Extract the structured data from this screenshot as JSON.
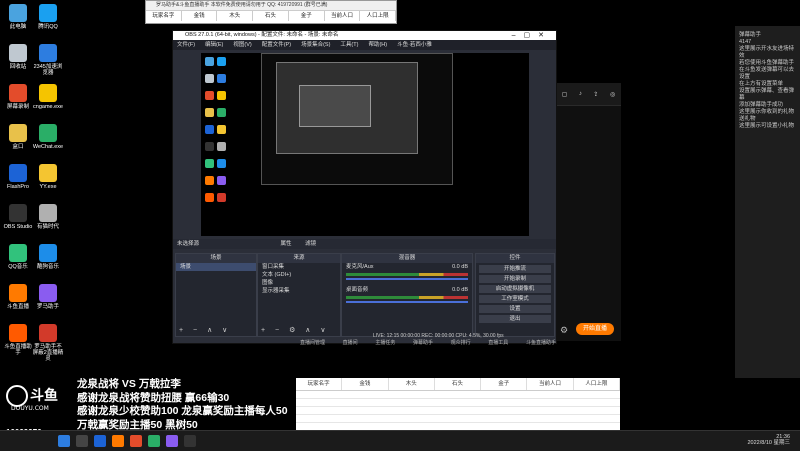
{
  "desktop_icons": [
    {
      "label": "此电脑",
      "color": "#4aa3df"
    },
    {
      "label": "腾讯QQ",
      "color": "#1aa0f0"
    },
    {
      "label": "回收站",
      "color": "#bfc8d0"
    },
    {
      "label": "2345加速浏览器",
      "color": "#2d7de0"
    },
    {
      "label": "屏幕录制",
      "color": "#e34c2b"
    },
    {
      "label": "cngame.exe",
      "color": "#f5c400"
    },
    {
      "label": "盒口",
      "color": "#e8c14a"
    },
    {
      "label": "WeChat.exe",
      "color": "#2aae67"
    },
    {
      "label": "FlashPro",
      "color": "#1c63d6"
    },
    {
      "label": "YY.exe",
      "color": "#f4c531"
    },
    {
      "label": "OBS Studio",
      "color": "#333333"
    },
    {
      "label": "有猫时代",
      "color": "#b0b0b0"
    },
    {
      "label": "QQ音乐",
      "color": "#31c27c"
    },
    {
      "label": "酷狗音乐",
      "color": "#1d8de9"
    },
    {
      "label": "斗鱼直播",
      "color": "#ff7a00"
    },
    {
      "label": "罗马助手",
      "color": "#8a5cf0"
    },
    {
      "label": "斗鱼直播助手",
      "color": "#ff5a00"
    },
    {
      "label": "罗马助手不屏蔽2直播精灵",
      "color": "#d23a2a"
    }
  ],
  "sheet_top": {
    "title": "罗马助手&斗鱼直播助手   本软件免费使用请勿用于  QQ: 419720991  (群号已满)",
    "headers": [
      "玩家名字",
      "金钱",
      "木头",
      "石头",
      "金子",
      "当前人口",
      "人口上限"
    ]
  },
  "obs": {
    "title": "OBS 27.0.1 (64-bit, windows) - 配置文件: 未命名 - 场景: 未命名",
    "menu": [
      "文件(F)",
      "编辑(E)",
      "视图(V)",
      "配置文件(P)",
      "场景集合(S)",
      "工具(T)",
      "帮助(H)",
      "斗鱼·若西小雅"
    ],
    "selected_source_label": "未选择源",
    "properties_label": "属性",
    "filters_label": "滤镜",
    "docks": {
      "scenes": {
        "title": "场景",
        "items": [
          "场景"
        ]
      },
      "sources": {
        "title": "来源",
        "items": [
          "窗口采集",
          "文本 (GDI+)",
          "图像",
          "显示器采集"
        ]
      },
      "mixer": {
        "title": "混音器",
        "channels": [
          {
            "name": "麦克风/Aux",
            "db": "0.0 dB"
          },
          {
            "name": "桌面音频",
            "db": "0.0 dB"
          }
        ]
      },
      "controls": {
        "title": "控件",
        "buttons": [
          "开始推流",
          "开始录制",
          "启动虚拟摄像机",
          "工作室模式",
          "设置",
          "退出"
        ]
      }
    },
    "tabs": [
      "控件",
      "场景转换"
    ],
    "status": "LIVE: 12:15   00:00:00   REC: 00:00:00   CPU: 4.5%, 30.00 fps"
  },
  "client": {
    "start_label": "开始直播",
    "bottom_menu": [
      "直播间管理",
      "直播间",
      "主播任务",
      "弹幕助手",
      "观众排行",
      "直播工具",
      "斗鱼直播助手"
    ]
  },
  "right_panel": {
    "lines": [
      "弹幕助手",
      "4147",
      "这里展示开水友进场特效",
      "",
      "若您使用斗鱼弹幕助手",
      "在斗鱼发送弹幕可以去设置",
      "在上方有设置菜单",
      "设置展示弹幕、查看弹幕",
      "添加弹幕助手成功",
      "",
      "这里展示你收到的礼物",
      "送礼物",
      "这里展示可设置小礼物"
    ]
  },
  "overlay_lines": [
    "龙泉战将 VS 万戟拉李",
    "感谢龙泉战将赞助扭腰 赢66输30",
    "感谢龙泉少校赞助100 龙泉赢奖励主播每人50",
    "万戟赢奖励主播50 黑树50"
  ],
  "douyu": {
    "logo_text": "斗鱼",
    "site": "DOUYU.COM",
    "room_id": "10029976"
  },
  "sheet_bottom": {
    "headers": [
      "玩家名字",
      "金钱",
      "木头",
      "石头",
      "金子",
      "当前人口",
      "人口上限"
    ]
  },
  "taskbar": {
    "time": "21:36",
    "date": "2022/8/10 星期三"
  },
  "colors": {
    "accent_orange": "#ff7a00",
    "obs_bg": "#2b2e38",
    "meter_green": "#2e8b3a"
  }
}
